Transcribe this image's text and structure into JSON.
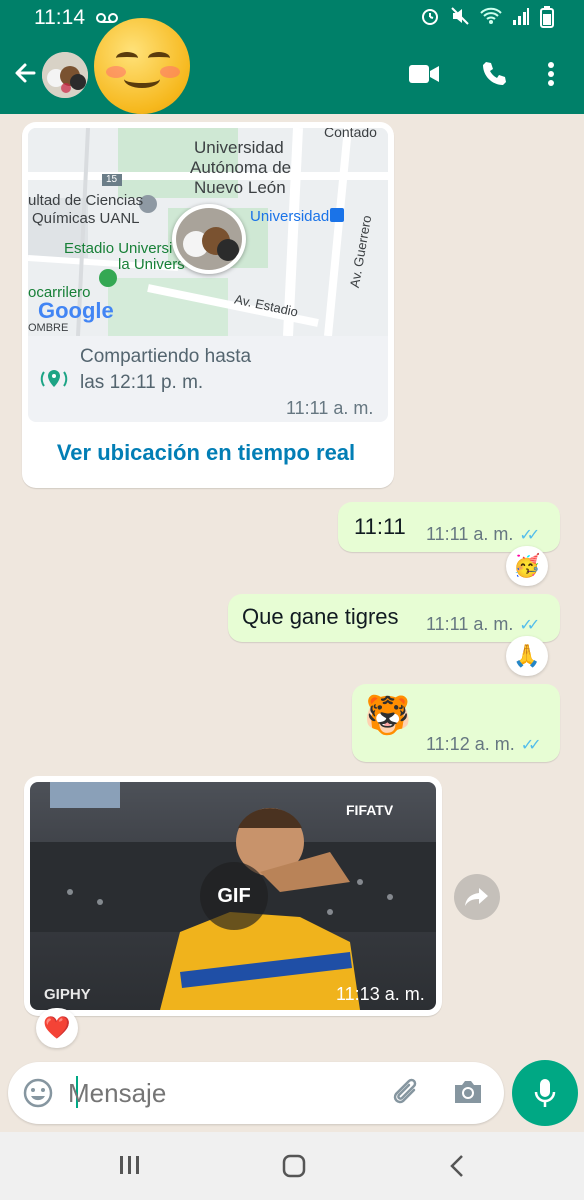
{
  "status_bar": {
    "time": "11:14",
    "icons": [
      "voicemail-icon",
      "alarm-icon",
      "mute-icon",
      "wifi-icon",
      "signal-icon",
      "battery-icon"
    ]
  },
  "header": {
    "icons": [
      "back-arrow-icon",
      "video-call-icon",
      "voice-call-icon",
      "more-options-icon"
    ],
    "accent": "#008069"
  },
  "messages": {
    "location": {
      "map_labels": {
        "uni": "Universidad",
        "autonoma": "Autónoma de",
        "nuevo_leon": "Nuevo León",
        "facultad": "ultad de Ciencias",
        "quimicas": "Químicas UANL",
        "metro": "Universidad",
        "estadio": "Estadio Universi",
        "la_uni": "la Univers",
        "tranvia": "ocarrilero",
        "av_estadio": "Av. Estadio",
        "av_guerrero": "Av. Guerrero",
        "google": "Google",
        "road_15": "15",
        "contado": "Contado",
        "nombre": "OMBRE"
      },
      "sharing_text": "Compartiendo hasta las 12:11 p. m.",
      "time": "11:11 a. m.",
      "link": "Ver ubicación en tiempo real"
    },
    "out1": {
      "text": "11:11",
      "time": "11:11 a. m.",
      "reaction": "🥳"
    },
    "out2": {
      "text": "Que gane tigres",
      "time": "11:11 a. m.",
      "reaction": "🙏"
    },
    "out3": {
      "text": "🐯",
      "time": "11:12 a. m."
    },
    "gif": {
      "badge": "GIF",
      "source": "GIPHY",
      "watermark": "FIFATV",
      "time": "11:13 a. m.",
      "reaction": "❤️"
    }
  },
  "composer": {
    "placeholder": "Mensaje",
    "icons": [
      "emoji-icon",
      "attach-icon",
      "camera-icon",
      "mic-icon"
    ]
  },
  "colors": {
    "header": "#008069",
    "chat_bg": "#efe7de",
    "out_bubble": "#e7fdd4",
    "tick_blue": "#53bdeb",
    "link_blue": "#027eb5",
    "mic_green": "#00a884"
  }
}
